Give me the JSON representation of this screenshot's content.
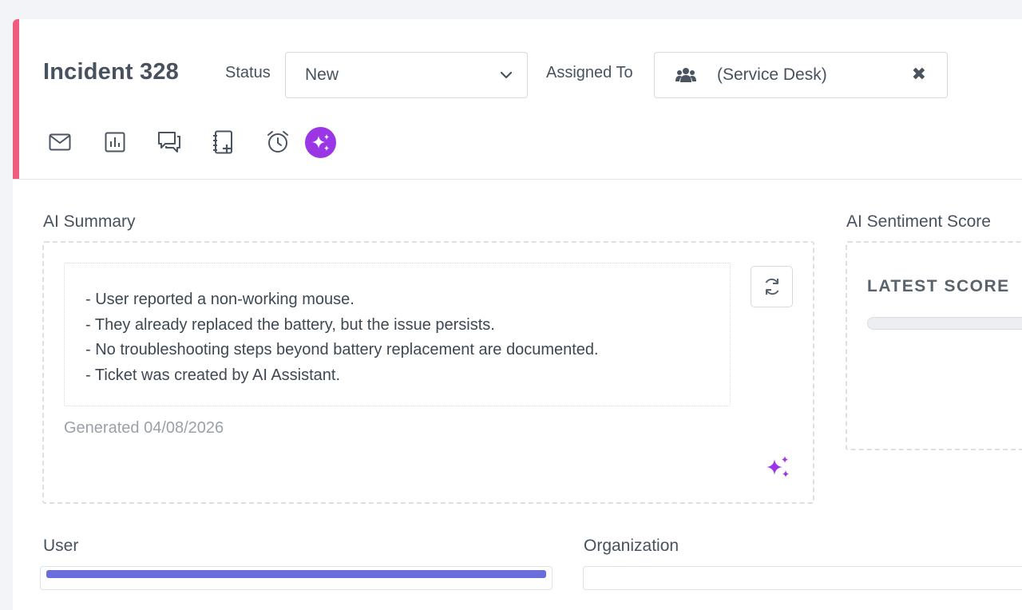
{
  "header": {
    "title": "Incident 328",
    "status_label": "Status",
    "status_value": "New",
    "assigned_label": "Assigned To",
    "assigned_value": "(Service Desk)"
  },
  "toolbar": {
    "icons": [
      "mail-icon",
      "report-icon",
      "comments-icon",
      "notebook-add-icon",
      "alarm-clock-icon",
      "ai-sparkle-icon"
    ]
  },
  "ai_summary": {
    "title": "AI Summary",
    "lines": [
      "- User reported a non-working mouse.",
      "- They already replaced the battery, but the issue persists.",
      "- No troubleshooting steps beyond battery replacement are documented.",
      "- Ticket was created by AI Assistant."
    ],
    "generated": "Generated 04/08/2026"
  },
  "ai_sentiment": {
    "title": "AI Sentiment Score",
    "latest_label": "LATEST SCORE",
    "score_fraction": 0
  },
  "lower": {
    "user_label": "User",
    "organization_label": "Organization"
  },
  "colors": {
    "accent": "#ee5d7e",
    "ai_purple": "#9b36e6",
    "user_strip": "#6a6edc"
  }
}
